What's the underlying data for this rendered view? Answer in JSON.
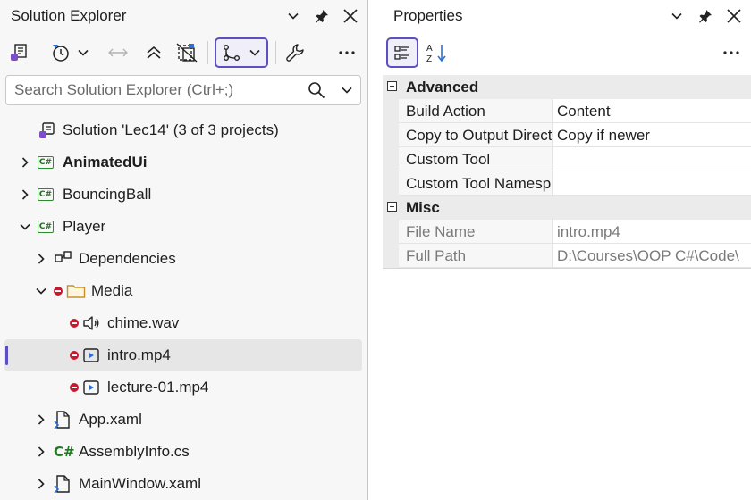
{
  "solution_explorer": {
    "title": "Solution Explorer",
    "search_placeholder": "Search Solution Explorer (Ctrl+;)",
    "tree": [
      {
        "label": "Solution 'Lec14' (3 of 3 projects)",
        "icon": "solution-icon",
        "indent": 0,
        "expander": "none",
        "bold": false
      },
      {
        "label": "AnimatedUi",
        "icon": "csharp-project-icon",
        "indent": 0,
        "expander": "collapsed",
        "bold": true
      },
      {
        "label": "BouncingBall",
        "icon": "csharp-project-icon",
        "indent": 0,
        "expander": "collapsed",
        "bold": false
      },
      {
        "label": "Player",
        "icon": "csharp-project-icon",
        "indent": 0,
        "expander": "expanded",
        "bold": false
      },
      {
        "label": "Dependencies",
        "icon": "dependencies-icon",
        "indent": 1,
        "expander": "collapsed",
        "bold": false
      },
      {
        "label": "Media",
        "icon": "folder-icon",
        "indent": 1,
        "expander": "expanded",
        "bold": false,
        "excluded": true
      },
      {
        "label": "chime.wav",
        "icon": "audio-file-icon",
        "indent": 2,
        "expander": "none",
        "bold": false,
        "excluded": true
      },
      {
        "label": "intro.mp4",
        "icon": "video-file-icon",
        "indent": 2,
        "expander": "none",
        "bold": false,
        "excluded": true,
        "selected": true
      },
      {
        "label": "lecture-01.mp4",
        "icon": "video-file-icon",
        "indent": 2,
        "expander": "none",
        "bold": false,
        "excluded": true
      },
      {
        "label": "App.xaml",
        "icon": "xaml-file-icon",
        "indent": 1,
        "expander": "collapsed",
        "bold": false
      },
      {
        "label": "AssemblyInfo.cs",
        "icon": "csharp-file-icon",
        "indent": 1,
        "expander": "collapsed",
        "bold": false
      },
      {
        "label": "MainWindow.xaml",
        "icon": "xaml-file-icon",
        "indent": 1,
        "expander": "collapsed",
        "bold": false
      }
    ]
  },
  "properties": {
    "title": "Properties",
    "sort_az_label": "A Z",
    "categories": [
      {
        "name": "Advanced",
        "rows": [
          {
            "name": "Build Action",
            "value": "Content",
            "readonly": false
          },
          {
            "name": "Copy to Output Directory",
            "value": "Copy if newer",
            "readonly": false
          },
          {
            "name": "Custom Tool",
            "value": "",
            "readonly": false
          },
          {
            "name": "Custom Tool Namespace",
            "value": "",
            "readonly": false
          }
        ]
      },
      {
        "name": "Misc",
        "rows": [
          {
            "name": "File Name",
            "value": "intro.mp4",
            "readonly": true
          },
          {
            "name": "Full Path",
            "value": "D:\\Courses\\OOP C#\\Code\\",
            "readonly": true
          }
        ]
      }
    ]
  },
  "colors": {
    "accent": "#5b4fc2",
    "exclude_red": "#c5192d",
    "csharp_green": "#2b8a2b"
  }
}
